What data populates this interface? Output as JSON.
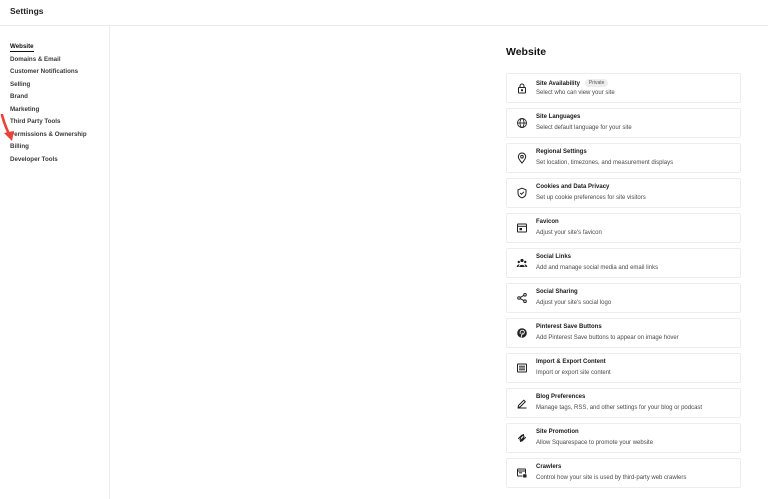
{
  "header": {
    "title": "Settings"
  },
  "sidebar": {
    "items": [
      {
        "label": "Website"
      },
      {
        "label": "Domains & Email"
      },
      {
        "label": "Customer Notifications"
      },
      {
        "label": "Selling"
      },
      {
        "label": "Brand"
      },
      {
        "label": "Marketing"
      },
      {
        "label": "Third Party Tools"
      },
      {
        "label": "Permissions & Ownership"
      },
      {
        "label": "Billing"
      },
      {
        "label": "Developer Tools"
      }
    ],
    "active_index": 0
  },
  "annotation": {
    "icon": "red-arrow-icon",
    "color": "#e8423a"
  },
  "main": {
    "title": "Website",
    "cards": [
      {
        "title": "Site Availability",
        "badge": "Private",
        "desc": "Select who can view your site",
        "icon": "lock-icon"
      },
      {
        "title": "Site Languages",
        "desc": "Select default language for your site",
        "icon": "globe-icon"
      },
      {
        "title": "Regional Settings",
        "desc": "Set location, timezones, and measurement displays",
        "icon": "location-pin-icon"
      },
      {
        "title": "Cookies and Data Privacy",
        "desc": "Set up cookie preferences for site visitors",
        "icon": "shield-check-icon"
      },
      {
        "title": "Favicon",
        "desc": "Adjust your site's favicon",
        "icon": "browser-window-icon"
      },
      {
        "title": "Social Links",
        "desc": "Add and manage social media and email links",
        "icon": "people-icon"
      },
      {
        "title": "Social Sharing",
        "desc": "Adjust your site's social logo",
        "icon": "share-icon"
      },
      {
        "title": "Pinterest Save Buttons",
        "desc": "Add Pinterest Save buttons to appear on image hover",
        "icon": "pinterest-icon"
      },
      {
        "title": "Import & Export Content",
        "desc": "Import or export site content",
        "icon": "list-icon"
      },
      {
        "title": "Blog Preferences",
        "desc": "Manage tags, RSS, and other settings for your blog or podcast",
        "icon": "pen-icon"
      },
      {
        "title": "Site Promotion",
        "desc": "Allow Squarespace to promote your website",
        "icon": "squarespace-logo-icon"
      },
      {
        "title": "Crawlers",
        "desc": "Control how your site is used by third-party web crawlers",
        "icon": "crawler-icon"
      }
    ]
  }
}
